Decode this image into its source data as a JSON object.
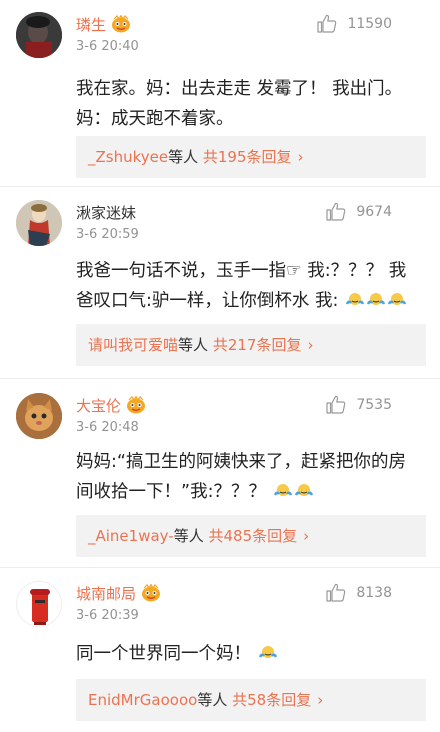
{
  "comments": [
    {
      "author": "璘生",
      "author_color": "#eb7350",
      "verified_badge": "vip-badge-icon",
      "time": "3-6 20:40",
      "likes": "11590",
      "text": [
        "我在家。妈：出去走走 发霉了！  我出门。",
        "妈：成天跑不着家。"
      ],
      "reply_user": "_Zshukyee",
      "reply_mid": "等人",
      "reply_count": "共195条回复",
      "reply_chevron": "›"
    },
    {
      "author": "湫家迷妹",
      "author_color": "#333333",
      "time": "3-6 20:59",
      "likes": "9674",
      "text": [
        "我爸一句话不说，玉手一指☞ 我:？？？ 我",
        "爸叹口气:驴一样，让你倒杯水 我:"
      ],
      "reply_user": "请叫我可爱喵",
      "reply_mid": "等人",
      "reply_count": "共217条回复",
      "reply_chevron": "›"
    },
    {
      "author": "大宝伦",
      "author_color": "#eb7350",
      "verified_badge": "vip-badge-icon",
      "time": "3-6 20:48",
      "likes": "7535",
      "text": [
        "妈妈:“搞卫生的阿姨快来了，赶紧把你的房",
        "间收拾一下！”我:？？？"
      ],
      "reply_user": "_Aine1way-",
      "reply_mid": "等人",
      "reply_count": "共485条回复",
      "reply_chevron": "›"
    },
    {
      "author": "城南邮局",
      "author_color": "#eb7350",
      "verified_badge": "vip-badge-icon",
      "time": "3-6 20:39",
      "likes": "8138",
      "text": [
        "同一个世界同一个妈！"
      ],
      "reply_user": "EnidMrGaoooo",
      "reply_mid": "等人",
      "reply_count": "共58条回复",
      "reply_chevron": "›"
    }
  ]
}
